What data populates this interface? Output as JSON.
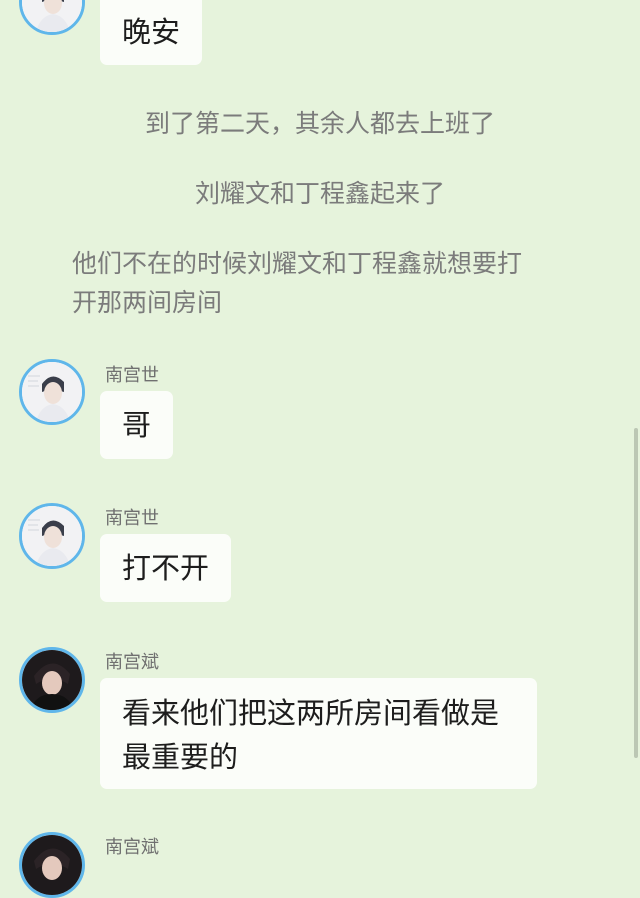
{
  "messages": [
    {
      "sender": "",
      "text": "晚安"
    },
    {
      "sender": "南宫世",
      "text": "哥"
    },
    {
      "sender": "南宫世",
      "text": "打不开"
    },
    {
      "sender": "南宫斌",
      "text_line1": "看来他们把这两所房间看做是",
      "text_line2": "最重要的"
    },
    {
      "sender": "南宫斌"
    }
  ],
  "narration": [
    "到了第二天，其余人都去上班了",
    "刘耀文和丁程鑫起来了",
    "他们不在的时候刘耀文和丁程鑫就想要打",
    "开那两间房间"
  ],
  "colors": {
    "background": "#e6f3dc",
    "bubble": "#fbfdf9",
    "avatar_ring": "#5fb6ea",
    "narration_text": "#7b7b7b",
    "sender_text": "#707070"
  },
  "icons": [
    "avatar-nangongshi",
    "avatar-nangongbin"
  ]
}
